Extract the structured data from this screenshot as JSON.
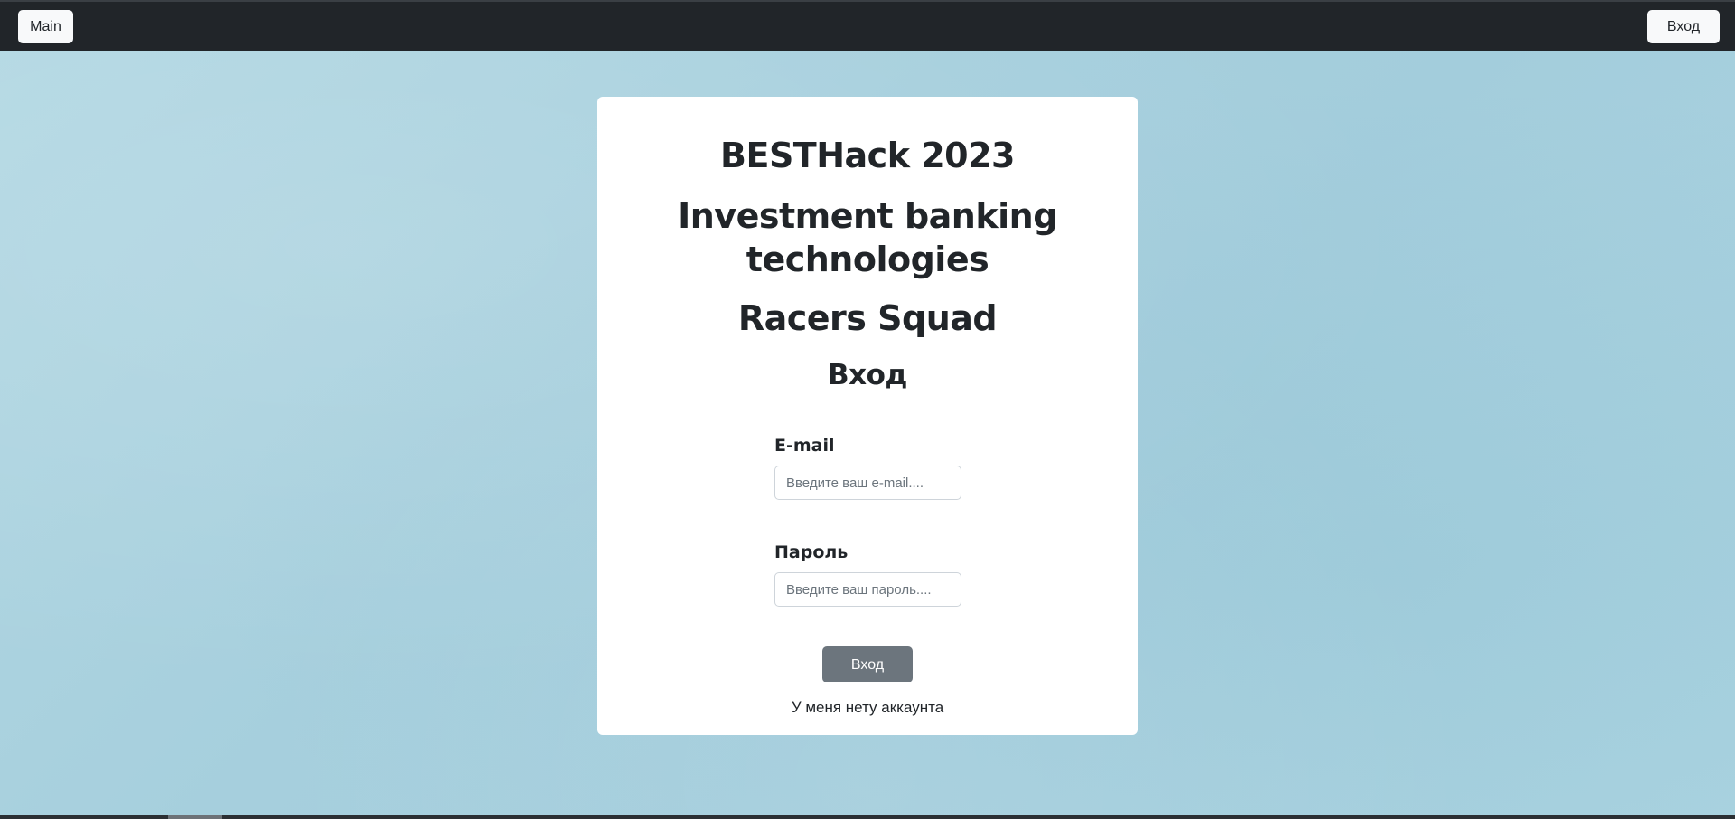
{
  "navbar": {
    "main_label": "Main",
    "login_label": "Вход"
  },
  "card": {
    "title": "BESTHack 2023",
    "subtitle": "Investment banking technologies",
    "team": "Racers Squad",
    "heading": "Вход",
    "email": {
      "label": "E-mail",
      "placeholder": "Введите ваш e-mail....",
      "value": ""
    },
    "password": {
      "label": "Пароль",
      "placeholder": "Введите ваш пароль....",
      "value": ""
    },
    "submit_label": "Вход",
    "no_account_label": "У меня нету аккаунта"
  },
  "colors": {
    "navbar_bg": "#212529",
    "page_bg": "#a9d2df",
    "card_bg": "#ffffff",
    "submit_bg": "#6c757d"
  }
}
